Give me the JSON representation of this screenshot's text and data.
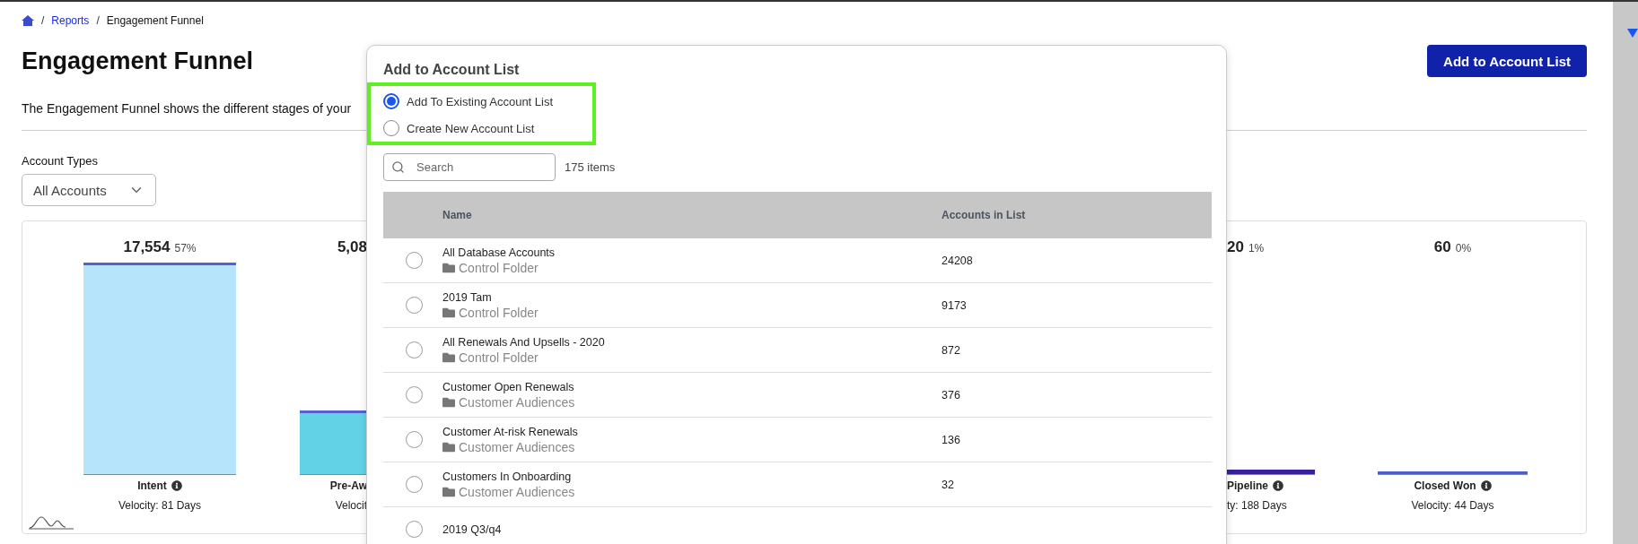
{
  "breadcrumb": {
    "items": [
      {
        "separator": "/",
        "label": "Reports",
        "kind": "link"
      },
      {
        "separator": "/",
        "label": "Engagement Funnel",
        "kind": "current"
      }
    ]
  },
  "page": {
    "title": "Engagement Funnel",
    "description": "The Engagement Funnel shows the different stages of your",
    "action_button": "Add to Account List"
  },
  "filter": {
    "label": "Account Types",
    "value": "All Accounts"
  },
  "funnel": {
    "stages": [
      {
        "kind": "full",
        "count": "17,554",
        "percent": "57%",
        "label": "Intent",
        "info": true,
        "velocity": "Velocity: 81 Days",
        "level": 1,
        "color": "#b5e4fb"
      },
      {
        "kind": "cut_right",
        "count": "5,08",
        "label": "Pre-Aw",
        "info": false,
        "velocity": "Velocit",
        "level": 0.29,
        "color": "#62d2e6"
      },
      {
        "kind": "cut_left",
        "count": "20",
        "percent": "1%",
        "label": "Pipeline",
        "info": true,
        "velocity": "ty: 188 Days",
        "level": 0.01,
        "color": "#3a1f9e"
      },
      {
        "kind": "full",
        "count": "60",
        "percent": "0%",
        "label": "Closed Won",
        "info": true,
        "velocity": "Velocity: 44 Days",
        "level": 0,
        "color": "#4a5fd0"
      }
    ]
  },
  "modal": {
    "title": "Add to Account List",
    "options": [
      {
        "label": "Add To Existing Account List",
        "selected": true
      },
      {
        "label": "Create New Account List",
        "selected": false
      }
    ],
    "search": {
      "placeholder": "Search"
    },
    "item_count": "175 items",
    "table": {
      "columns": [
        "Name",
        "Accounts in List"
      ],
      "rows": [
        {
          "name": "All Database Accounts",
          "folder": "Control Folder",
          "count": "24208",
          "selected": false
        },
        {
          "name": "2019 Tam",
          "folder": "Control Folder",
          "count": "9173",
          "selected": false
        },
        {
          "name": "All Renewals And Upsells - 2020",
          "folder": "Control Folder",
          "count": "872",
          "selected": false
        },
        {
          "name": "Customer Open Renewals",
          "folder": "Customer Audiences",
          "count": "376",
          "selected": false
        },
        {
          "name": "Customer At-risk Renewals",
          "folder": "Customer Audiences",
          "count": "136",
          "selected": false
        },
        {
          "name": "Customers In Onboarding",
          "folder": "Customer Audiences",
          "count": "32",
          "selected": false
        },
        {
          "name": "2019 Q3/q4",
          "selected": false
        }
      ]
    }
  }
}
